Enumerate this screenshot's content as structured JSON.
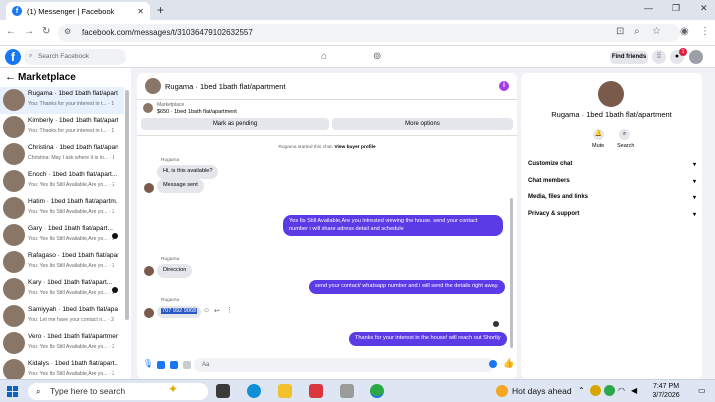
{
  "browser": {
    "tab_title": "(1) Messenger | Facebook",
    "url": "facebook.com/messages/t/31036479102632557"
  },
  "fb": {
    "search_placeholder": "Search Facebook",
    "find_friends": "Find friends",
    "notification_count": "1"
  },
  "sidebar": {
    "title": "Marketplace",
    "conversations": [
      {
        "title": "Rugama · 1bed 1bath flat/apart...",
        "preview": "You: Thanks for your interest in t... · 1m",
        "active": true
      },
      {
        "title": "Kimberly · 1bed 1bath flat/apart...",
        "preview": "You: Thanks for your interest in t... · 1m"
      },
      {
        "title": "Christina · 1bed 1bath flat/apart...",
        "preview": "Christina: May I ask where it is lo... · 8m"
      },
      {
        "title": "Enoch · 1bed 1bath flat/apart...",
        "preview": "You: Yes Its Still Available,Are yo... · 22m"
      },
      {
        "title": "Hatim · 1bed 1bath flat/apartm...",
        "preview": "You: Yes Its Still Available,Are yo... · 22m"
      },
      {
        "title": "Gary · 1bed 1bath flat/apart...",
        "preview": "You: Yes Its Still Available,Are yo... · 22m"
      },
      {
        "title": "Rafagaso · 1bed 1bath flat/apar...",
        "preview": "You: Yes Its Still Available,Are yo... · 22m"
      },
      {
        "title": "Kary · 1bed 1bath flat/apart...",
        "preview": "You: Yes Its Still Available,Are yo... · 22m"
      },
      {
        "title": "Samiyyah · 1bed 1bath flat/apar...",
        "preview": "You: Let me have your contact n... · 22m"
      },
      {
        "title": "Vero · 1bed 1bath flat/apartment",
        "preview": "You: Yes Its Still Available,Are yo... · 22m"
      },
      {
        "title": "Kidalys · 1bed 1bath flat/apart...",
        "preview": "You: Yes Its Still Available,Are yo... · 22m"
      }
    ]
  },
  "chat": {
    "header_name": "Rugama · 1bed 1bath flat/apartment",
    "listing_label": "Marketplace",
    "listing_title": "$650 · 1bed 1bath flat/apartment",
    "mark_pending": "Mark as pending",
    "more_options": "More options",
    "started_note_prefix": "Rugama started this chat.",
    "started_note_link": "View buyer profile",
    "sender_name": "Rugama",
    "msg1": "Hi, is this available?",
    "msg2": "Message sent",
    "msg3": "Yes Its Still Available,Are you intrested viewing the house. send your contact number i will share adress detail and schedule",
    "msg4": "Direccion",
    "msg5": "send your contact/ whatsapp number and i will send the details right away.",
    "msg6": "707 992 9068",
    "msg7": "Thanks for your interest in the house! will reach out Shortly",
    "composer_placeholder": "Aa"
  },
  "right_panel": {
    "title": "Rugama · 1bed 1bath flat/apartment",
    "mute": "Mute",
    "search": "Search",
    "rows": [
      "Customize chat",
      "Chat members",
      "Media, files and links",
      "Privacy & support"
    ]
  },
  "taskbar": {
    "search_placeholder": "Type here to search",
    "weather": "Hot days ahead",
    "time": "7:47 PM",
    "date": "3/7/2026"
  },
  "colors": {
    "fb_blue": "#1877f2",
    "outgoing_bubble": "#5b3be6",
    "incoming_bubble": "#e4e6eb"
  }
}
